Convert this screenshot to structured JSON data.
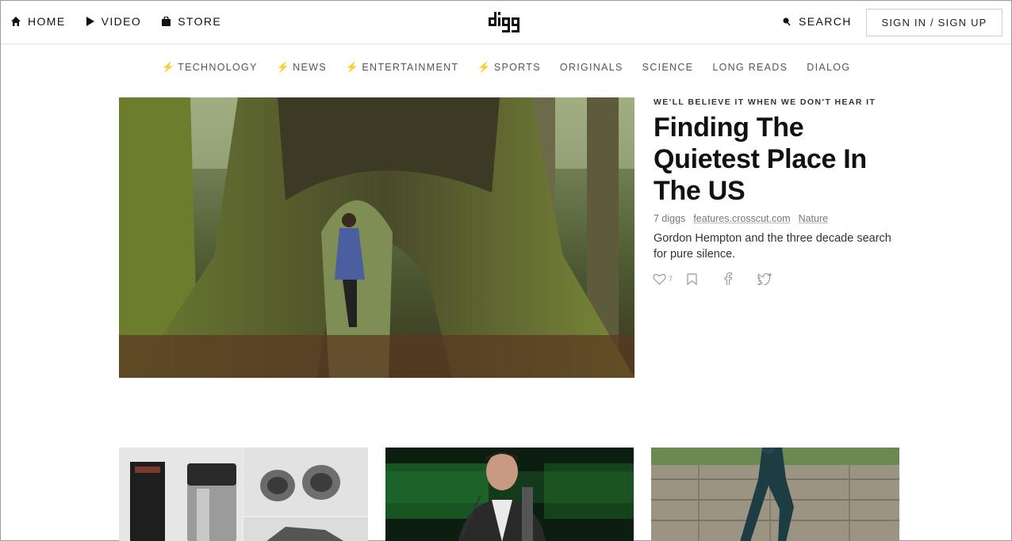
{
  "header": {
    "nav": [
      {
        "label": "HOME",
        "icon": "home-icon"
      },
      {
        "label": "VIDEO",
        "icon": "play-icon"
      },
      {
        "label": "STORE",
        "icon": "bag-icon"
      }
    ],
    "logo_text": "digg",
    "search_label": "SEARCH",
    "signin_label": "SIGN IN / SIGN UP"
  },
  "categories": [
    {
      "label": "TECHNOLOGY",
      "bolt": "⚡"
    },
    {
      "label": "NEWS",
      "bolt": "⚡"
    },
    {
      "label": "ENTERTAINMENT",
      "bolt": "⚡"
    },
    {
      "label": "SPORTS",
      "bolt": "⚡"
    },
    {
      "label": "ORIGINALS",
      "bolt": ""
    },
    {
      "label": "SCIENCE",
      "bolt": ""
    },
    {
      "label": "LONG READS",
      "bolt": ""
    },
    {
      "label": "DIALOG",
      "bolt": ""
    }
  ],
  "hero": {
    "kicker": "WE'LL BELIEVE IT WHEN WE DON'T HEAR IT",
    "headline": "Finding The Quietest Place In The US",
    "diggs": "7 diggs",
    "source": "features.crosscut.com",
    "tag": "Nature",
    "description": "Gordon Hempton and the three decade search for pure silence.",
    "like_count": "7"
  },
  "colors": {
    "accent": "#f26522",
    "text": "#111111",
    "muted": "#777777"
  }
}
